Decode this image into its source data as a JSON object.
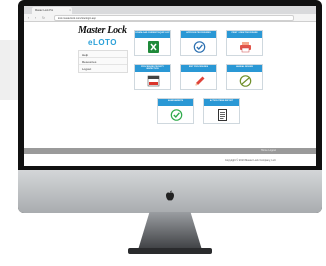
{
  "browser": {
    "tab_title": "Master Lock Pro",
    "url": "lock.masterlock.com/site/login.asp"
  },
  "brand": {
    "logo": "Master Lock",
    "logo_sub": "eLOTO",
    "app_name": "eLOTO",
    "accent": "#2a98d5"
  },
  "sidebar": {
    "items": [
      {
        "label": "Help"
      },
      {
        "label": "Resources"
      },
      {
        "label": "Logout"
      }
    ]
  },
  "tiles": [
    {
      "title": "DOWNLOAD CURRENT EQUIP. LIST",
      "icon": "excel-icon"
    },
    {
      "title": "APPROVE PROCEDURES",
      "icon": "check-circle-icon"
    },
    {
      "title": "PRINT / VIEW PROCEDURE",
      "icon": "printer-icon"
    },
    {
      "title": "PROCEDURE PRIORITY INSPECTION",
      "icon": "calendar-icon"
    },
    {
      "title": "EDIT PROCEDURES",
      "icon": "pencil-icon"
    },
    {
      "title": "ANNUAL REVIEW",
      "icon": "review-icon"
    },
    {
      "title": "ASSESSMENTS",
      "icon": "checkmark-icon"
    },
    {
      "title": "ACTION ITEMS REPORT",
      "icon": "document-icon"
    }
  ],
  "footer": {
    "links": "Home   Logout",
    "copyright": "Copyright © 2013 Master Lock Company, LLC"
  }
}
